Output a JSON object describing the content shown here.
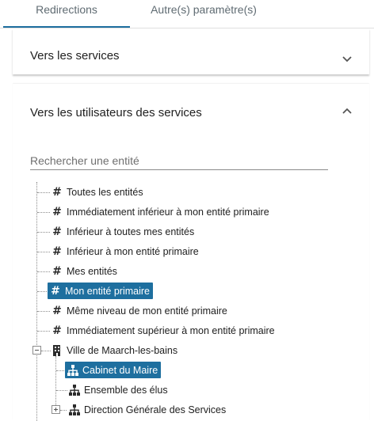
{
  "tabs": [
    {
      "label": "Redirections",
      "active": true
    },
    {
      "label": "Autre(s) paramètre(s)",
      "active": false
    }
  ],
  "panels": {
    "services": {
      "title": "Vers les services",
      "expanded": false
    },
    "users": {
      "title": "Vers les utilisateurs des services",
      "expanded": true
    }
  },
  "search": {
    "placeholder": "Rechercher une entité",
    "value": ""
  },
  "tree": {
    "items": [
      {
        "label": "Toutes les entités",
        "icon": "hash-icon"
      },
      {
        "label": "Immédiatement inférieur à mon entité primaire",
        "icon": "hash-icon"
      },
      {
        "label": "Inférieur à toutes mes entités",
        "icon": "hash-icon"
      },
      {
        "label": "Inférieur à mon entité primaire",
        "icon": "hash-icon"
      },
      {
        "label": "Mes entités",
        "icon": "hash-icon"
      },
      {
        "label": "Mon entité primaire",
        "icon": "hash-icon",
        "selected": true
      },
      {
        "label": "Même niveau de mon entité primaire",
        "icon": "hash-icon"
      },
      {
        "label": "Immédiatement supérieur à mon entité primaire",
        "icon": "hash-icon"
      },
      {
        "label": "Ville de Maarch-les-bains",
        "icon": "building-icon",
        "expanded": true
      },
      {
        "label": "Cabinet du Maire",
        "icon": "org-chart-icon",
        "selected": true
      },
      {
        "label": "Ensemble des élus",
        "icon": "org-chart-icon"
      },
      {
        "label": "Direction Générale des Services",
        "icon": "org-chart-icon",
        "expanded": false
      }
    ]
  },
  "colors": {
    "accent": "#1e6f9f",
    "text": "#212121",
    "muted": "#5f6b72"
  }
}
